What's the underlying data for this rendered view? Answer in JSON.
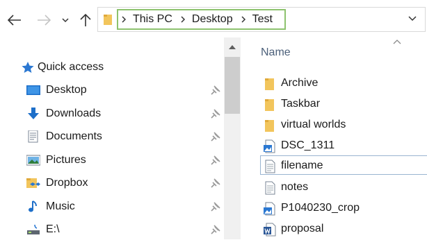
{
  "nav_buttons": {
    "back": "back-arrow-icon",
    "forward": "forward-arrow-icon",
    "recent": "chevron-down-icon",
    "up": "up-arrow-icon"
  },
  "address_bar": {
    "breadcrumbs": [
      "This PC",
      "Desktop",
      "Test"
    ],
    "highlight_color": "#8dc26e"
  },
  "navigation_pane": {
    "quick_access_label": "Quick access",
    "items": [
      {
        "label": "Desktop",
        "icon": "desktop-icon",
        "pinned": true
      },
      {
        "label": "Downloads",
        "icon": "download-icon",
        "pinned": true
      },
      {
        "label": "Documents",
        "icon": "documents-icon",
        "pinned": true
      },
      {
        "label": "Pictures",
        "icon": "pictures-icon",
        "pinned": true
      },
      {
        "label": "Dropbox",
        "icon": "dropbox-icon",
        "pinned": true
      },
      {
        "label": "Music",
        "icon": "music-icon",
        "pinned": true
      },
      {
        "label": "E:\\",
        "icon": "drive-icon",
        "pinned": true
      }
    ]
  },
  "content": {
    "column_header": "Name",
    "files": [
      {
        "name": "Archive",
        "icon": "folder-icon"
      },
      {
        "name": "Taskbar",
        "icon": "folder-icon"
      },
      {
        "name": "virtual worlds",
        "icon": "folder-icon"
      },
      {
        "name": "DSC_1311",
        "icon": "image-file-icon"
      },
      {
        "name": "filename",
        "icon": "text-file-icon"
      },
      {
        "name": "notes",
        "icon": "text-file-icon"
      },
      {
        "name": "P1040230_crop",
        "icon": "image-file-icon"
      },
      {
        "name": "proposal",
        "icon": "word-document-icon"
      }
    ]
  },
  "colors": {
    "folder": "#f2c55c",
    "accent_blue": "#2b78d2",
    "column_header_text": "#4c607a"
  }
}
